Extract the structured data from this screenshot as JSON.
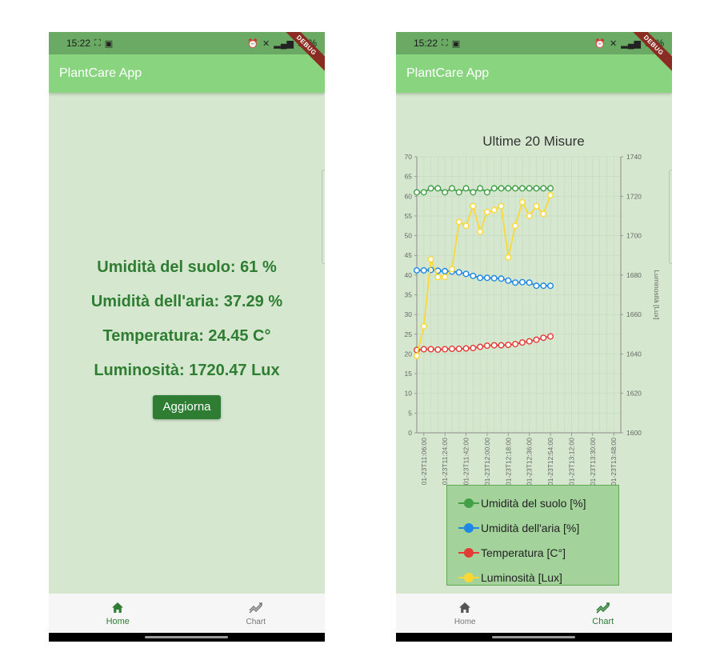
{
  "status": {
    "time": "15:22",
    "battery": "69%"
  },
  "app": {
    "title": "PlantCare App",
    "debug_banner": "DEBUG"
  },
  "home": {
    "soil": "Umidità del suolo: 61 %",
    "air": "Umidità dell'aria: 37.29 %",
    "temp": "Temperatura: 24.45 C°",
    "lux": "Luminosità: 1720.47 Lux",
    "refresh_label": "Aggiorna"
  },
  "nav": {
    "home_label": "Home",
    "chart_label": "Chart"
  },
  "icons": {
    "home": "home-icon",
    "chart": "trending-chart-icon"
  },
  "colors": {
    "appbar": "#88d47f",
    "statusbar": "#6aaa64",
    "background": "#d5e8cf",
    "primary": "#2e7d32",
    "legend_bg": "#a3d39b"
  },
  "chart_data": {
    "type": "line",
    "title": "Ultime 20 Misure",
    "xlabel": "",
    "ylabel": "",
    "y2label": "Luminosità [Lux]",
    "ylim": [
      0,
      70
    ],
    "y2lim": [
      1600,
      1740
    ],
    "yticks": [
      "0",
      "5",
      "10",
      "15",
      "20",
      "25",
      "30",
      "35",
      "40",
      "45",
      "50",
      "55",
      "60",
      "65",
      "70"
    ],
    "y2ticks": [
      "1600",
      "1620",
      "1640",
      "1660",
      "1680",
      "1700",
      "1720",
      "1740"
    ],
    "x": [
      "2024-01-23T11:00:00",
      "2024-01-23T11:06:00",
      "2024-01-23T11:12:00",
      "2024-01-23T11:18:00",
      "2024-01-23T11:24:00",
      "2024-01-23T11:30:00",
      "2024-01-23T11:36:00",
      "2024-01-23T11:42:00",
      "2024-01-23T11:48:00",
      "2024-01-23T11:54:00",
      "2024-01-23T12:00:00",
      "2024-01-23T12:06:00",
      "2024-01-23T12:12:00",
      "2024-01-23T12:18:00",
      "2024-01-23T12:24:00",
      "2024-01-23T12:30:00",
      "2024-01-23T12:36:00",
      "2024-01-23T12:42:00",
      "2024-01-23T12:48:00",
      "2024-01-23T12:54:00",
      "2024-01-23T13:00:00",
      "2024-01-23T13:06:00",
      "2024-01-23T13:12:00",
      "2024-01-23T13:18:00",
      "2024-01-23T13:24:00",
      "2024-01-23T13:30:00",
      "2024-01-23T13:36:00",
      "2024-01-23T13:42:00",
      "2024-01-23T13:48:00",
      "2024-01-23T13:54:00"
    ],
    "xtick_labels": [
      "2024-01-23T11:06:00",
      "2024-01-23T11:24:00",
      "2024-01-23T11:42:00",
      "2024-01-23T12:00:00",
      "2024-01-23T12:18:00",
      "2024-01-23T12:36:00",
      "2024-01-23T12:54:00",
      "2024-01-23T13:12:00",
      "2024-01-23T13:30:00",
      "2024-01-23T13:48:00"
    ],
    "series": [
      {
        "name": "Umidità del suolo [%]",
        "color": "#43a047",
        "axis": "left",
        "x": [
          "2024-01-23T11:00:00",
          "2024-01-23T11:06:00",
          "2024-01-23T11:12:00",
          "2024-01-23T11:18:00",
          "2024-01-23T11:24:00",
          "2024-01-23T11:30:00",
          "2024-01-23T11:36:00",
          "2024-01-23T11:42:00",
          "2024-01-23T11:48:00",
          "2024-01-23T11:54:00",
          "2024-01-23T12:00:00",
          "2024-01-23T12:06:00",
          "2024-01-23T12:12:00",
          "2024-01-23T12:18:00",
          "2024-01-23T12:24:00",
          "2024-01-23T12:30:00",
          "2024-01-23T12:36:00",
          "2024-01-23T12:42:00",
          "2024-01-23T12:48:00",
          "2024-01-23T12:54:00"
        ],
        "values": [
          61,
          61,
          62,
          62,
          61,
          62,
          61,
          62,
          61,
          62,
          61,
          62,
          62,
          62,
          62,
          62,
          62,
          62,
          62,
          62
        ]
      },
      {
        "name": "Umidità dell'aria [%]",
        "color": "#1e88e5",
        "axis": "left",
        "x": [
          "2024-01-23T11:00:00",
          "2024-01-23T11:06:00",
          "2024-01-23T11:12:00",
          "2024-01-23T11:18:00",
          "2024-01-23T11:24:00",
          "2024-01-23T11:30:00",
          "2024-01-23T11:36:00",
          "2024-01-23T11:42:00",
          "2024-01-23T11:48:00",
          "2024-01-23T11:54:00",
          "2024-01-23T12:00:00",
          "2024-01-23T12:06:00",
          "2024-01-23T12:12:00",
          "2024-01-23T12:18:00",
          "2024-01-23T12:24:00",
          "2024-01-23T12:30:00",
          "2024-01-23T12:36:00",
          "2024-01-23T12:42:00",
          "2024-01-23T12:48:00",
          "2024-01-23T12:54:00"
        ],
        "values": [
          41.2,
          41.2,
          41.3,
          41.1,
          41.0,
          40.9,
          40.7,
          40.3,
          39.8,
          39.3,
          39.3,
          39.2,
          39.1,
          38.6,
          38.1,
          38.2,
          38.1,
          37.3,
          37.3,
          37.29
        ]
      },
      {
        "name": "Temperatura [C°]",
        "color": "#e53935",
        "axis": "left",
        "x": [
          "2024-01-23T11:00:00",
          "2024-01-23T11:06:00",
          "2024-01-23T11:12:00",
          "2024-01-23T11:18:00",
          "2024-01-23T11:24:00",
          "2024-01-23T11:30:00",
          "2024-01-23T11:36:00",
          "2024-01-23T11:42:00",
          "2024-01-23T11:48:00",
          "2024-01-23T11:54:00",
          "2024-01-23T12:00:00",
          "2024-01-23T12:06:00",
          "2024-01-23T12:12:00",
          "2024-01-23T12:18:00",
          "2024-01-23T12:24:00",
          "2024-01-23T12:30:00",
          "2024-01-23T12:36:00",
          "2024-01-23T12:42:00",
          "2024-01-23T12:48:00",
          "2024-01-23T12:54:00"
        ],
        "values": [
          21.0,
          21.2,
          21.2,
          21.1,
          21.2,
          21.3,
          21.3,
          21.4,
          21.5,
          21.8,
          22.1,
          22.2,
          22.2,
          22.3,
          22.5,
          22.9,
          23.2,
          23.6,
          24.1,
          24.45
        ]
      },
      {
        "name": "Luminosità [Lux]",
        "color": "#fdd835",
        "axis": "right",
        "x": [
          "2024-01-23T11:00:00",
          "2024-01-23T11:06:00",
          "2024-01-23T11:12:00",
          "2024-01-23T11:18:00",
          "2024-01-23T11:24:00",
          "2024-01-23T11:30:00",
          "2024-01-23T11:36:00",
          "2024-01-23T11:42:00",
          "2024-01-23T11:48:00",
          "2024-01-23T11:54:00",
          "2024-01-23T12:00:00",
          "2024-01-23T12:06:00",
          "2024-01-23T12:12:00",
          "2024-01-23T12:18:00",
          "2024-01-23T12:24:00",
          "2024-01-23T12:30:00",
          "2024-01-23T12:36:00",
          "2024-01-23T12:42:00",
          "2024-01-23T12:48:00",
          "2024-01-23T12:54:00"
        ],
        "values": [
          1639,
          1654,
          1688,
          1679,
          1679,
          1683,
          1707,
          1705,
          1715,
          1702,
          1712,
          1713,
          1715,
          1689,
          1705,
          1717,
          1710,
          1715,
          1711,
          1720.47
        ]
      }
    ],
    "grid": true,
    "legend": "bottom"
  }
}
